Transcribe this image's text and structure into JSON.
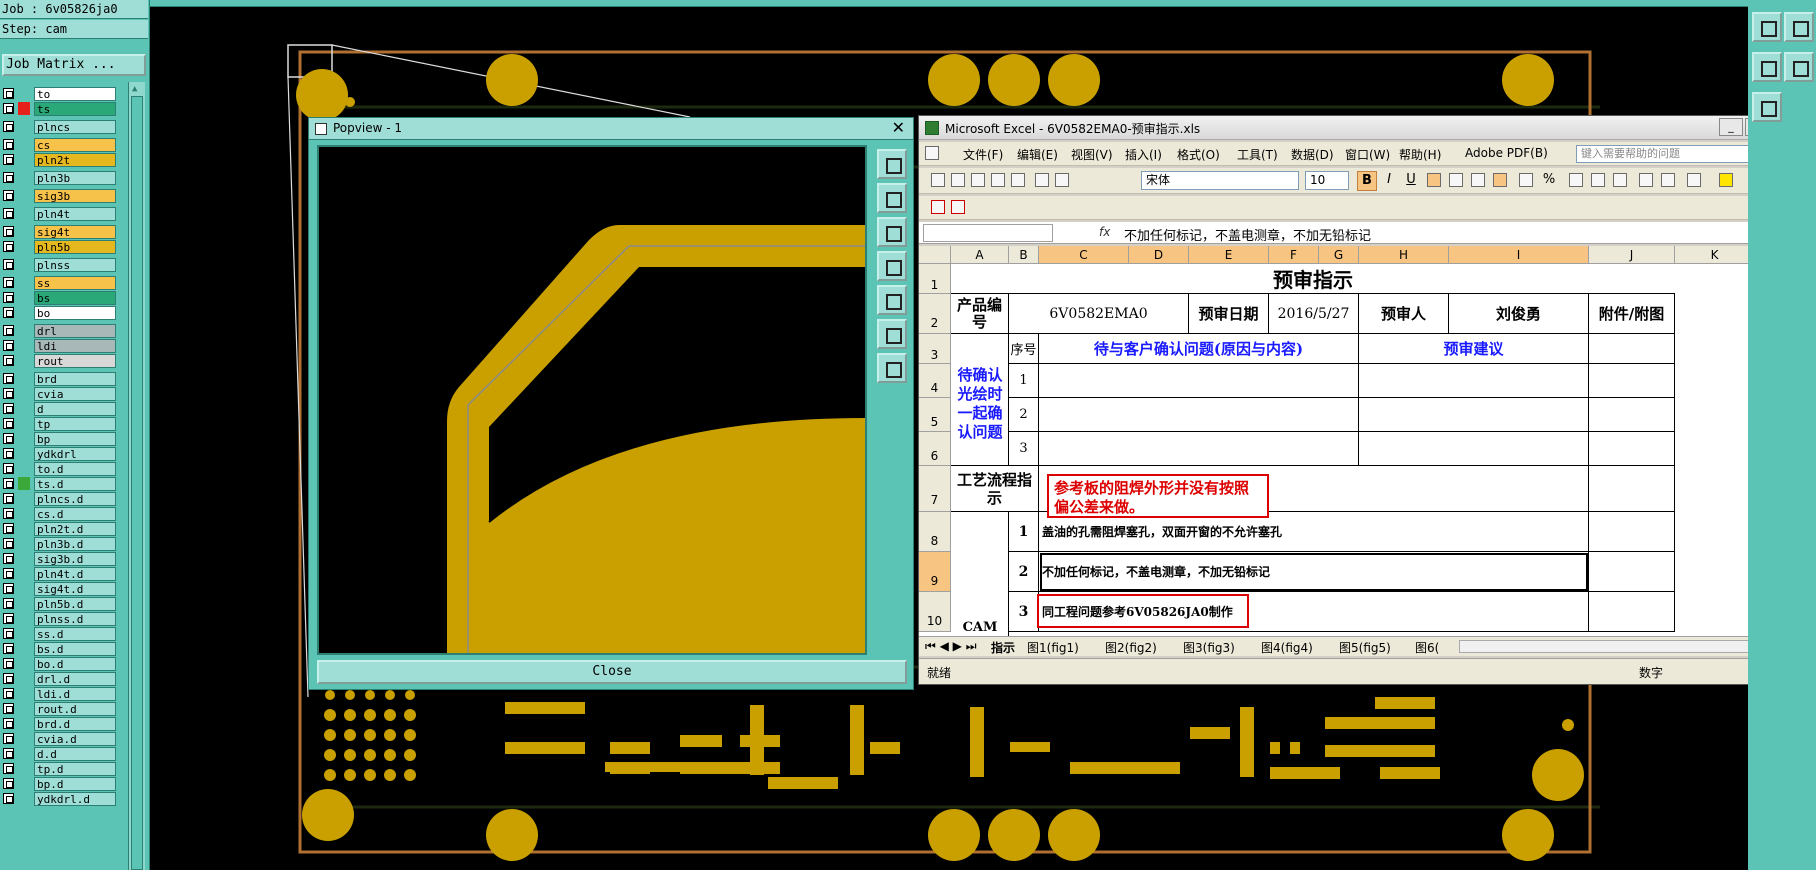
{
  "job_panel": {
    "job_label": "Job : 6v05826ja0",
    "step_label": "Step: cam",
    "matrix_button": "Job Matrix ...",
    "layers": [
      {
        "name": "to",
        "color": "#ffffff"
      },
      {
        "name": "ts",
        "color": "#2aa878",
        "selected": true
      },
      {
        "name": "plncs",
        "color": "#9fded6"
      },
      {
        "name": "cs",
        "color": "#f7c24a"
      },
      {
        "name": "pln2t",
        "color": "#e6b820"
      },
      {
        "name": "pln3b",
        "color": "#9fded6"
      },
      {
        "name": "sig3b",
        "color": "#f7c24a"
      },
      {
        "name": "pln4t",
        "color": "#9fded6"
      },
      {
        "name": "sig4t",
        "color": "#f7c24a"
      },
      {
        "name": "pln5b",
        "color": "#e6b820"
      },
      {
        "name": "plnss",
        "color": "#9fded6"
      },
      {
        "name": "ss",
        "color": "#f7c24a"
      },
      {
        "name": "bs",
        "color": "#2aa878"
      },
      {
        "name": "bo",
        "color": "#ffffff"
      },
      {
        "name": "drl",
        "color": "#a8b8b8"
      },
      {
        "name": "ldi",
        "color": "#a8b8b8"
      },
      {
        "name": "rout",
        "color": "#d8d8d8"
      },
      {
        "name": "brd",
        "color": "#9fded6"
      },
      {
        "name": "cvia",
        "color": "#9fded6"
      },
      {
        "name": "d",
        "color": "#9fded6"
      },
      {
        "name": "tp",
        "color": "#9fded6"
      },
      {
        "name": "bp",
        "color": "#9fded6"
      },
      {
        "name": "ydkdrl",
        "color": "#9fded6"
      },
      {
        "name": "to.d",
        "color": "#9fded6"
      },
      {
        "name": "ts.d",
        "color": "#9fded6"
      },
      {
        "name": "plncs.d",
        "color": "#9fded6"
      },
      {
        "name": "cs.d",
        "color": "#9fded6"
      },
      {
        "name": "pln2t.d",
        "color": "#9fded6"
      },
      {
        "name": "pln3b.d",
        "color": "#9fded6"
      },
      {
        "name": "sig3b.d",
        "color": "#9fded6"
      },
      {
        "name": "pln4t.d",
        "color": "#9fded6"
      },
      {
        "name": "sig4t.d",
        "color": "#9fded6"
      },
      {
        "name": "pln5b.d",
        "color": "#9fded6"
      },
      {
        "name": "plnss.d",
        "color": "#9fded6"
      },
      {
        "name": "ss.d",
        "color": "#9fded6"
      },
      {
        "name": "bs.d",
        "color": "#9fded6"
      },
      {
        "name": "bo.d",
        "color": "#9fded6"
      },
      {
        "name": "drl.d",
        "color": "#9fded6"
      },
      {
        "name": "ldi.d",
        "color": "#9fded6"
      },
      {
        "name": "rout.d",
        "color": "#9fded6"
      },
      {
        "name": "brd.d",
        "color": "#9fded6"
      },
      {
        "name": "cvia.d",
        "color": "#9fded6"
      },
      {
        "name": "d.d",
        "color": "#9fded6"
      },
      {
        "name": "tp.d",
        "color": "#9fded6"
      },
      {
        "name": "bp.d",
        "color": "#9fded6"
      },
      {
        "name": "ydkdrl.d",
        "color": "#9fded6"
      }
    ]
  },
  "popview": {
    "title": "Popview - 1",
    "close_x": "✕",
    "close_label": "Close"
  },
  "excel": {
    "title": "Microsoft Excel - 6V0582EMA0-预审指示.xls",
    "window_controls": [
      "_",
      "□",
      "✕"
    ],
    "menu": [
      "文件(F)",
      "编辑(E)",
      "视图(V)",
      "插入(I)",
      "格式(O)",
      "工具(T)",
      "数据(D)",
      "窗口(W)",
      "帮助(H)",
      "Adobe PDF(B)"
    ],
    "help_placeholder": "键入需要帮助的问题",
    "font_name": "宋体",
    "font_size": "10",
    "fx": "fx",
    "formula": "不加任何标记，不盖电测章，不加无铅标记",
    "columns": [
      "A",
      "B",
      "C",
      "D",
      "E",
      "F",
      "G",
      "H",
      "I",
      "J",
      "K"
    ],
    "rows": [
      "1",
      "2",
      "3",
      "4",
      "5",
      "6",
      "7",
      "8",
      "9",
      "10"
    ],
    "sheet": {
      "title": "预审指示",
      "product_label": "产品编号",
      "product_value": "6V0582EMA0",
      "date_label": "预审日期",
      "date_value": "2016/5/27",
      "reviewer_label": "预审人",
      "reviewer_value": "刘俊勇",
      "attachment_label": "附件/附图",
      "seq_label": "序号",
      "issues_header": "待与客户确认问题(原因与内容)",
      "advice_header": "预审建议",
      "pending_label": "待确认光绘时一起确认问题",
      "pending_nums": [
        "1",
        "2",
        "3"
      ],
      "process_label": "工艺流程指示",
      "cam_label": "CAM",
      "process_items": [
        {
          "num": "1",
          "text": "盖油的孔需阻焊塞孔，双面开窗的不允许塞孔"
        },
        {
          "num": "2",
          "text": "不加任何标记，不盖电测章，不加无铅标记"
        },
        {
          "num": "3",
          "text": "同工程问题参考6V05826JA0制作"
        }
      ],
      "note": "参考板的阻焊外形并没有按照偏公差来做。"
    },
    "tabs": [
      "指示",
      "图1(fig1)",
      "图2(fig2)",
      "图3(fig3)",
      "图4(fig4)",
      "图5(fig5)",
      "图6("
    ],
    "status_left": "就绪",
    "status_right": "数字"
  },
  "colors": {
    "panel": "#5cc4b4",
    "copper": "#c9a000",
    "board_outline": "#b07030"
  }
}
